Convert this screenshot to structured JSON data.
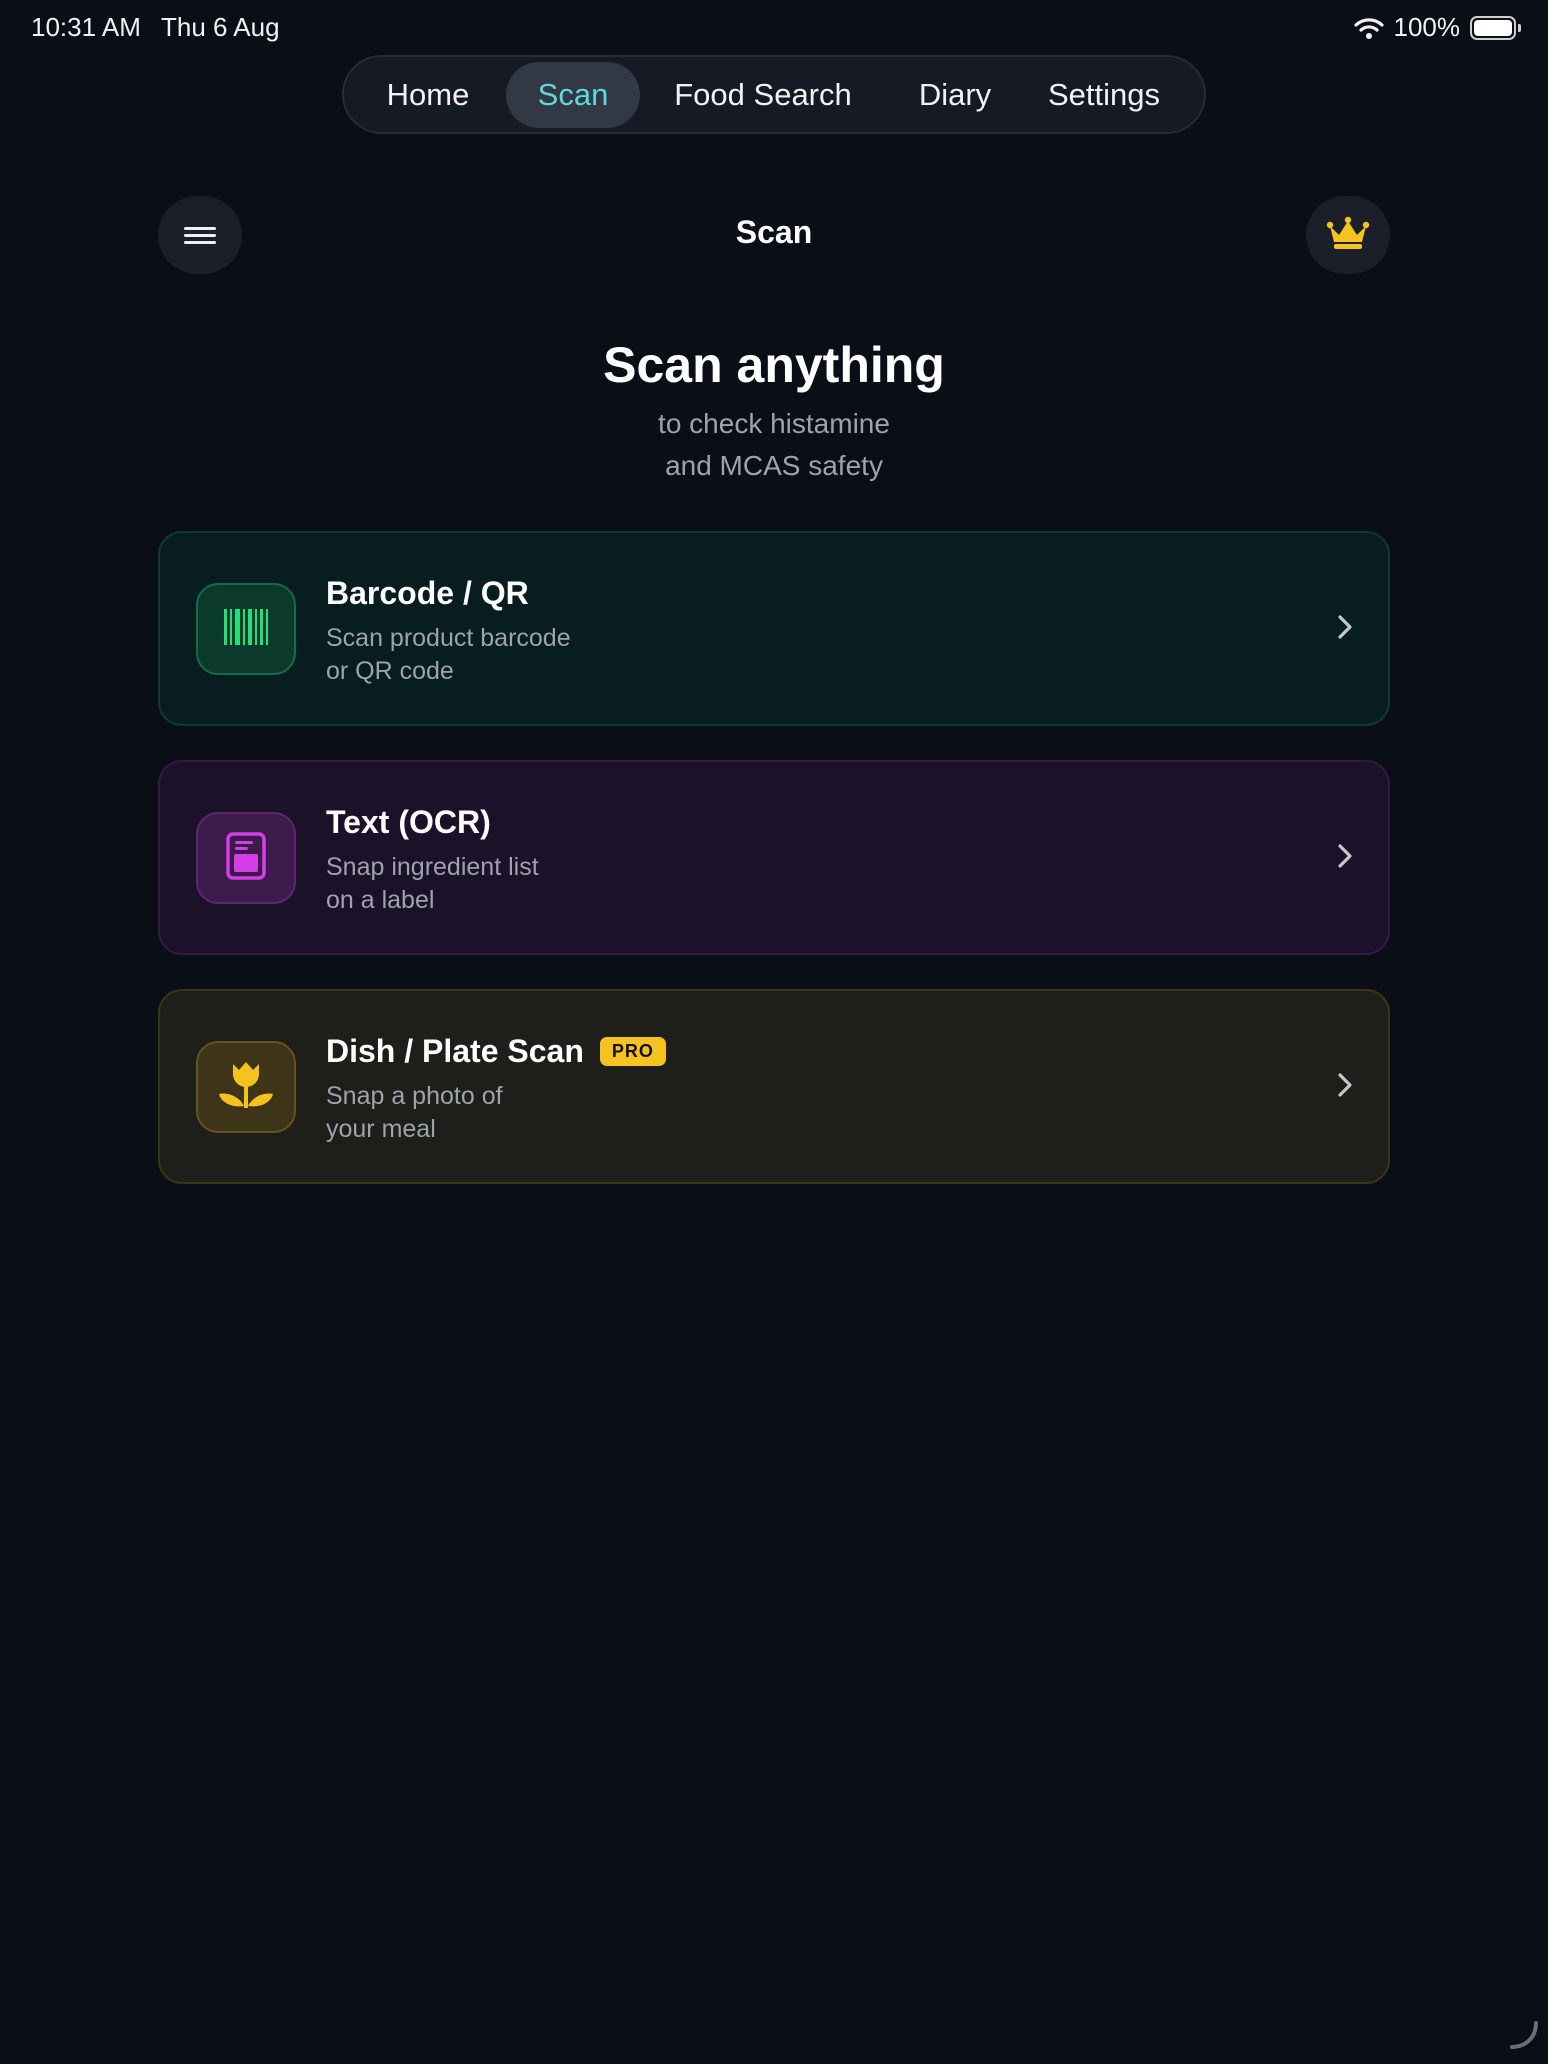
{
  "status_bar": {
    "time": "10:31 AM",
    "date": "Thu 6 Aug",
    "battery": "100%",
    "icons": [
      "wifi-icon",
      "battery-icon"
    ]
  },
  "tabs": [
    {
      "label": "Home",
      "active": false
    },
    {
      "label": "Scan",
      "active": true
    },
    {
      "label": "Food Search",
      "active": false
    },
    {
      "label": "Diary",
      "active": false
    },
    {
      "label": "Settings",
      "active": false
    }
  ],
  "header": {
    "title": "Scan",
    "left_icon": "menu-icon",
    "right_icon": "crown-icon"
  },
  "hero": {
    "title": "Scan anything",
    "subtitle_line1": "to check histamine",
    "subtitle_line2": "and MCAS safety"
  },
  "scan_options": [
    {
      "icon": "barcode-icon",
      "title": "Barcode / QR",
      "desc_line1": "Scan product barcode",
      "desc_line2": "or QR code"
    },
    {
      "icon": "document-text-icon",
      "title": "Text (OCR)",
      "desc_line1": "Snap ingredient list",
      "desc_line2": "on a label"
    },
    {
      "icon": "tulip-icon",
      "title": "Dish / Plate Scan",
      "badge": "PRO",
      "desc_line1": "Snap a photo of",
      "desc_line2": "your meal"
    }
  ],
  "colors": {
    "background": "#0a0e16",
    "active_tab_text": "#5ed8d8",
    "barcode_accent": "#22e07a",
    "ocr_accent": "#d63ce8",
    "dish_accent": "#f5c320",
    "crown": "#f5c320"
  }
}
